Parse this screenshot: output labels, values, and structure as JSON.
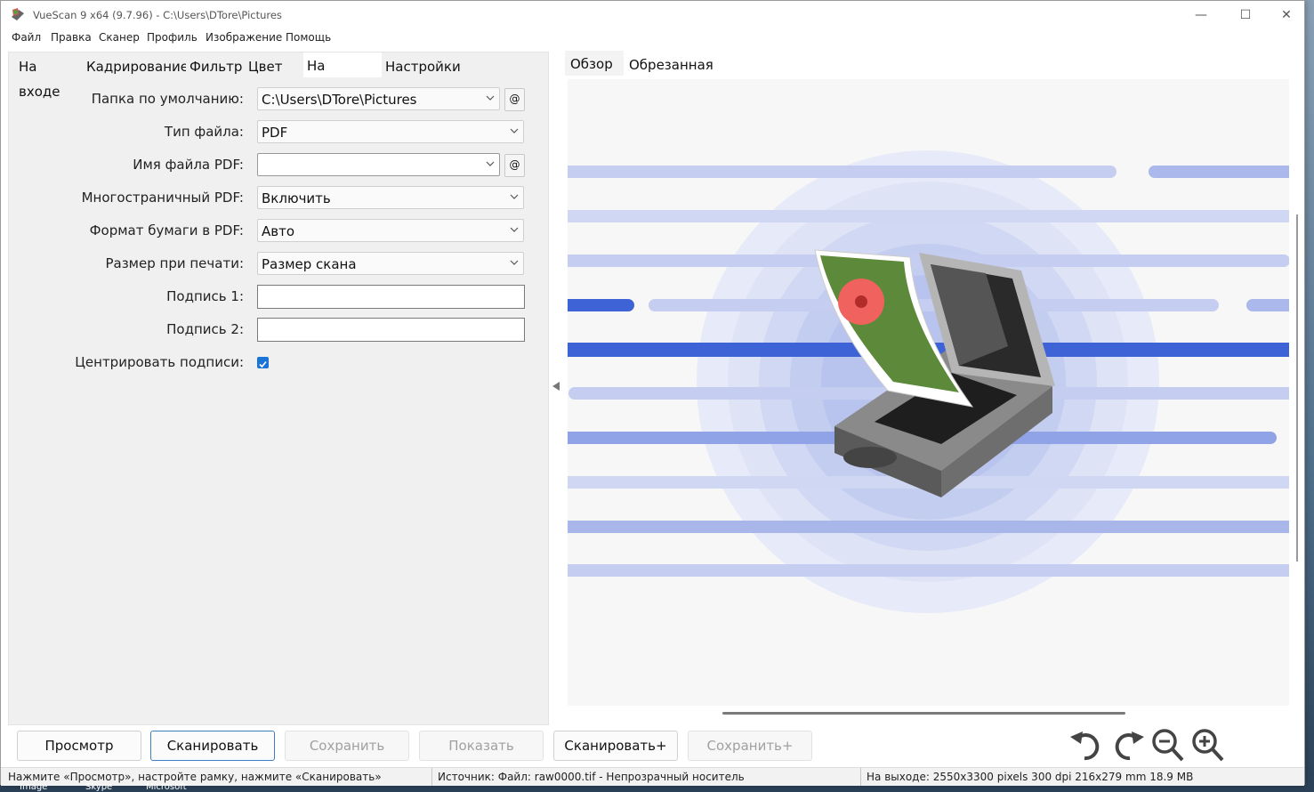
{
  "window": {
    "title": "VueScan 9 x64 (9.7.96) - C:\\Users\\DTore\\Pictures",
    "controls": {
      "minimize": "—",
      "maximize": "☐",
      "close": "✕"
    }
  },
  "menu": [
    "Файл",
    "Правка",
    "Сканер",
    "Профиль",
    "Изображение",
    "Помощь"
  ],
  "left_tabs": [
    "На входе",
    "Кадрирование",
    "Фильтр",
    "Цвет",
    "На выходе",
    "Настройки"
  ],
  "active_left_tab": "На выходе",
  "form": {
    "default_folder": {
      "label": "Папка по умолчанию:",
      "value": "C:\\Users\\DTore\\Pictures",
      "at": "@"
    },
    "file_type": {
      "label": "Тип файла:",
      "value": "PDF"
    },
    "pdf_file_name": {
      "label": "Имя файла PDF:",
      "value": "",
      "at": "@"
    },
    "multipage_pdf": {
      "label": "Многостраничный PDF:",
      "value": "Включить"
    },
    "pdf_paper_format": {
      "label": "Формат бумаги в PDF:",
      "value": "Авто"
    },
    "print_size": {
      "label": "Размер при печати:",
      "value": "Размер скана"
    },
    "caption1": {
      "label": "Подпись 1:",
      "value": ""
    },
    "caption2": {
      "label": "Подпись 2:",
      "value": ""
    },
    "center_captions": {
      "label": "Центрировать подписи:",
      "checked": true
    }
  },
  "right_tabs": [
    "Обзор",
    "Обрезанная область"
  ],
  "active_right_tab": "Обзор",
  "buttons": {
    "preview": "Просмотр",
    "scan": "Сканировать",
    "save": "Сохранить",
    "show": "Показать",
    "scan_plus": "Сканировать+",
    "save_plus": "Сохранить+"
  },
  "status": {
    "hint": "Нажмите «Просмотр», настройте рамку, нажмите «Сканировать»",
    "source": "Источник: Файл: raw0000.tif - Непрозрачный носитель",
    "output": "На выходе: 2550x3300 pixels 300 dpi 216x279 mm 18.9 MB"
  },
  "taskbar": [
    "Image",
    "Skype",
    "Microsoft"
  ],
  "colors": {
    "accent": "#1a73d6",
    "stripe_light": "#c5cdf0",
    "stripe_dark": "#3d63d6",
    "halo": "#b9c4ef"
  },
  "icons": [
    "rotate-left-icon",
    "rotate-right-icon",
    "zoom-out-icon",
    "zoom-in-icon"
  ]
}
